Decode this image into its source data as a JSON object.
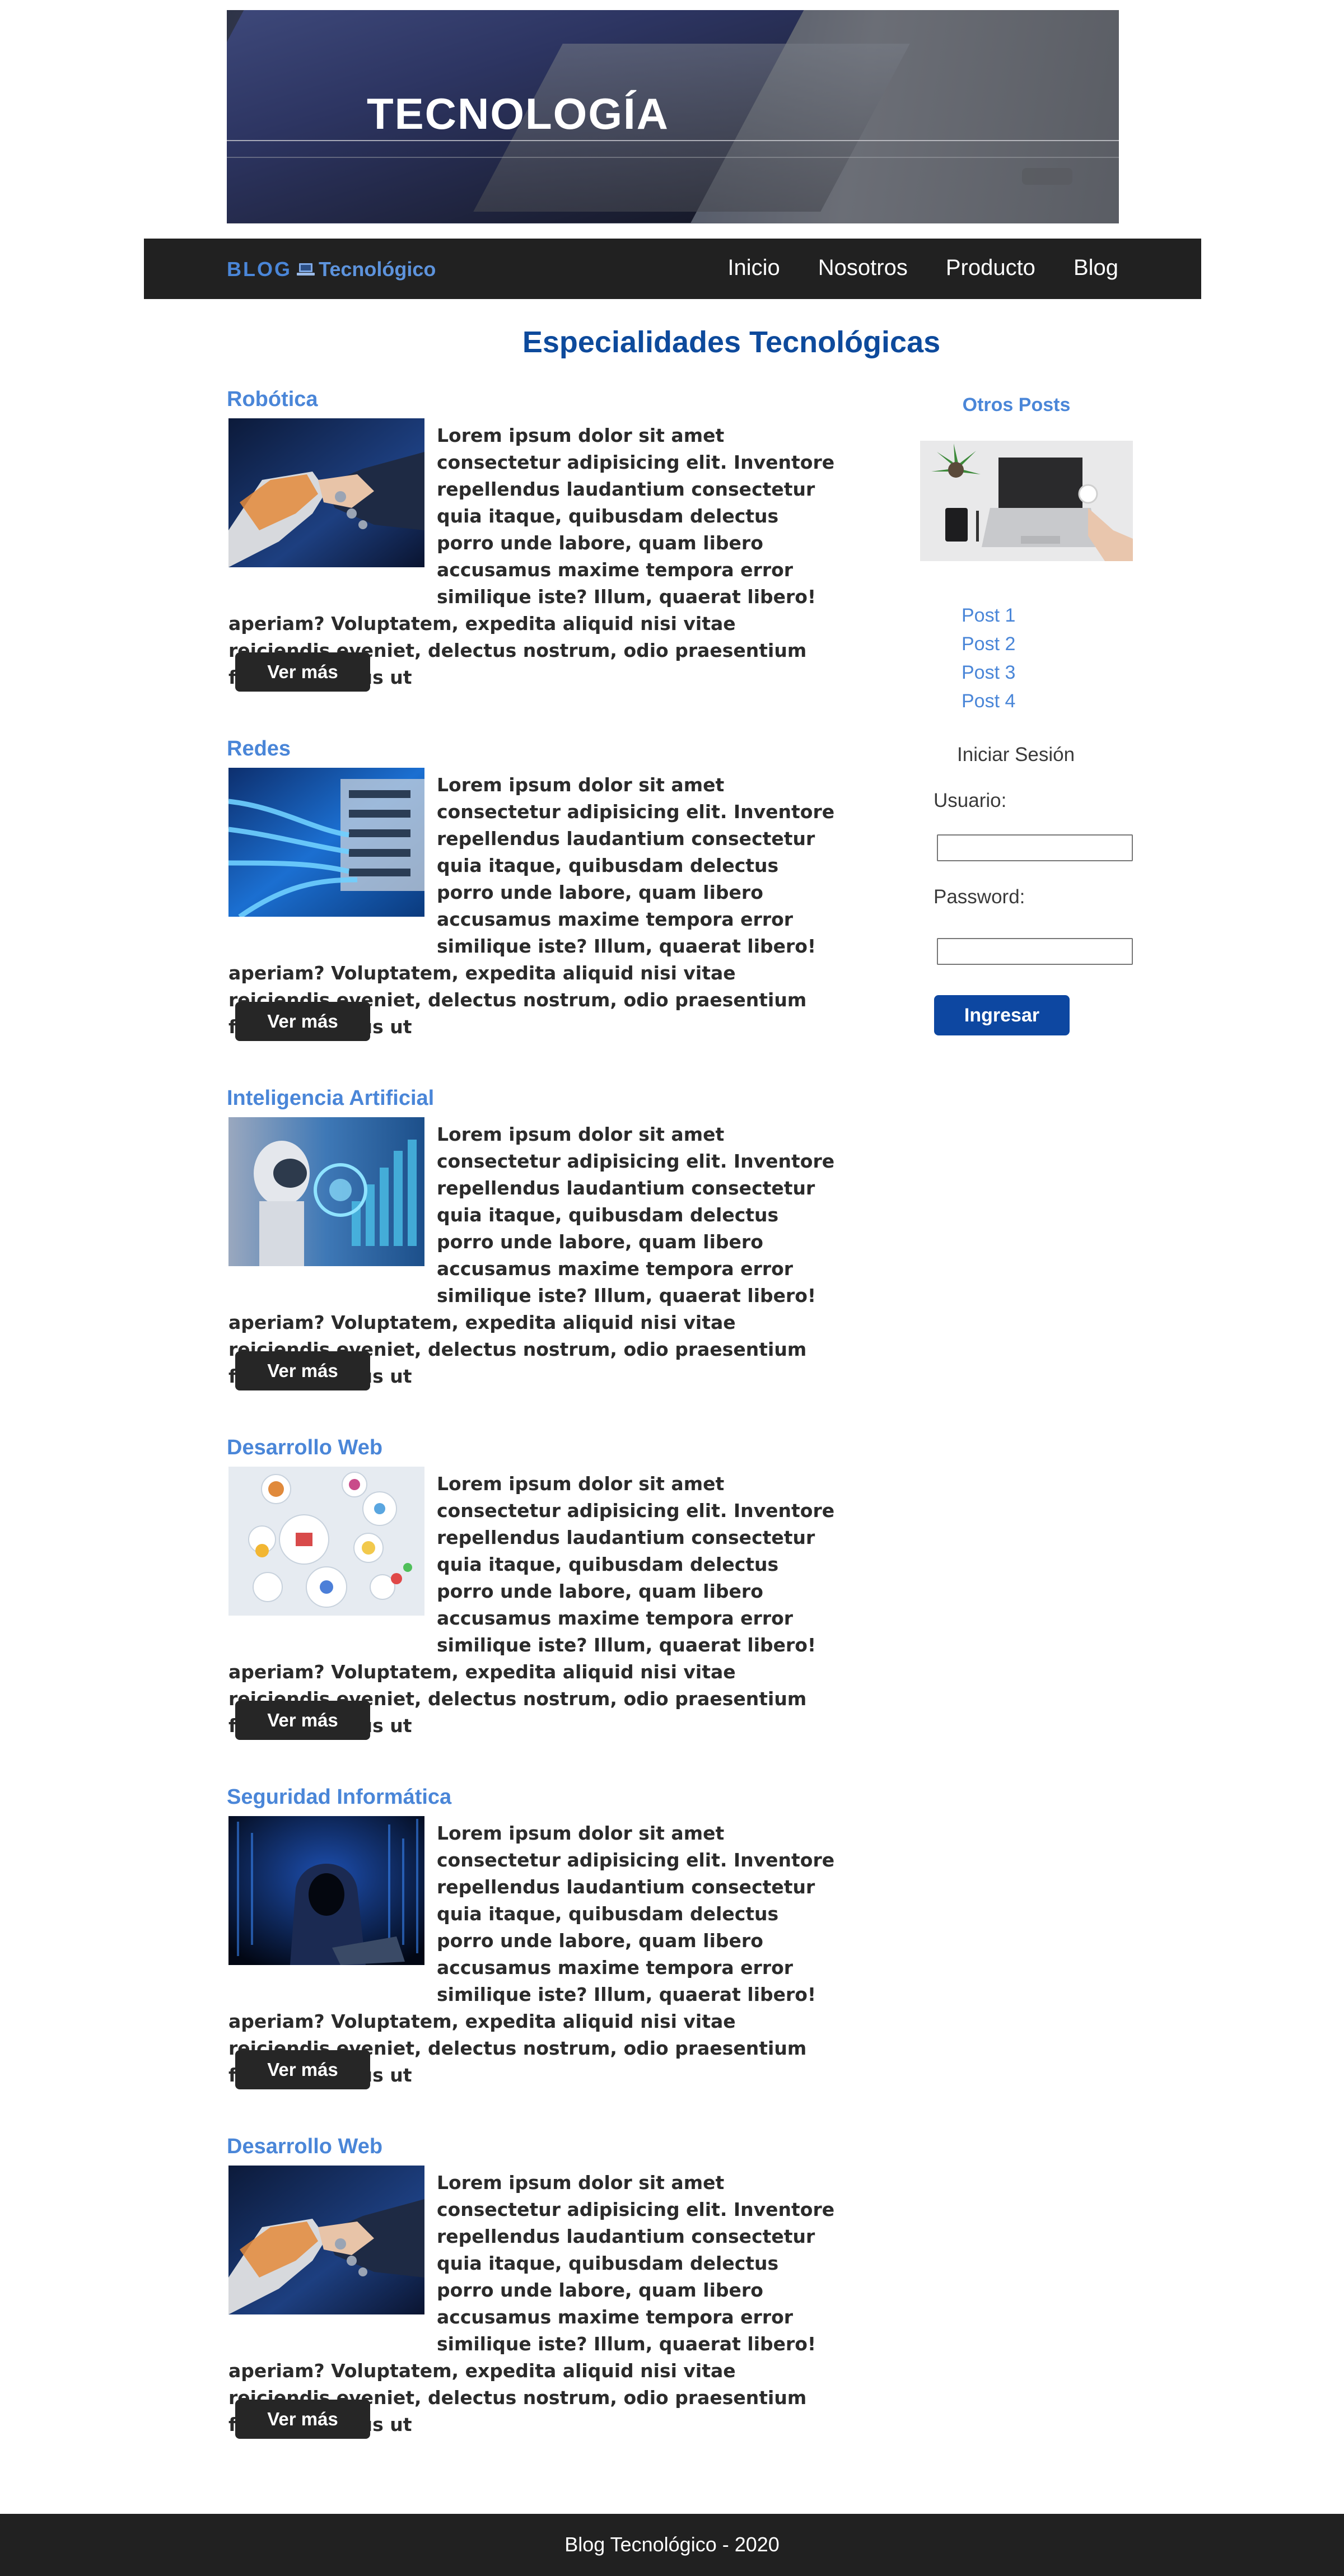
{
  "banner": {
    "title": "TECNOLOGÍA"
  },
  "navbar": {
    "brand_part1": "BLOG",
    "brand_icon": "laptop-icon",
    "brand_part2": "Tecnológico",
    "links": [
      "Inicio",
      "Nosotros",
      "Producto",
      "Blog"
    ]
  },
  "main": {
    "title": "Especialidades Tecnológicas",
    "articles": [
      {
        "title": "Robótica",
        "image": "robot-handshake",
        "text": "Lorem ipsum dolor sit amet consectetur adipisicing elit. Inventore repellendus laudantium consectetur quia itaque, quibusdam delectus porro unde labore, quam libero accusamus maxime tempora error similique iste? Illum, quaerat libero! aperiam? Voluptatem, expedita aliquid nisi vitae reiciendis eveniet, delectus nostrum, odio praesentium facilis ducimus ut",
        "button": "Ver más"
      },
      {
        "title": "Redes",
        "image": "network-cables",
        "text": "Lorem ipsum dolor sit amet consectetur adipisicing elit. Inventore repellendus laudantium consectetur quia itaque, quibusdam delectus porro unde labore, quam libero accusamus maxime tempora error similique iste? Illum, quaerat libero! aperiam? Voluptatem, expedita aliquid nisi vitae reiciendis eveniet, delectus nostrum, odio praesentium facilis ducimus ut",
        "button": "Ver más"
      },
      {
        "title": "Inteligencia Artificial",
        "image": "ai-robot",
        "text": "Lorem ipsum dolor sit amet consectetur adipisicing elit. Inventore repellendus laudantium consectetur quia itaque, quibusdam delectus porro unde labore, quam libero accusamus maxime tempora error similique iste? Illum, quaerat libero! aperiam? Voluptatem, expedita aliquid nisi vitae reiciendis eveniet, delectus nostrum, odio praesentium facilis ducimus ut",
        "button": "Ver más"
      },
      {
        "title": "Desarrollo Web",
        "image": "web-dev-diagram",
        "text": "Lorem ipsum dolor sit amet consectetur adipisicing elit. Inventore repellendus laudantium consectetur quia itaque, quibusdam delectus porro unde labore, quam libero accusamus maxime tempora error similique iste? Illum, quaerat libero! aperiam? Voluptatem, expedita aliquid nisi vitae reiciendis eveniet, delectus nostrum, odio praesentium facilis ducimus ut",
        "button": "Ver más"
      },
      {
        "title": "Seguridad Informática",
        "image": "hacker-hood",
        "text": "Lorem ipsum dolor sit amet consectetur adipisicing elit. Inventore repellendus laudantium consectetur quia itaque, quibusdam delectus porro unde labore, quam libero accusamus maxime tempora error similique iste? Illum, quaerat libero! aperiam? Voluptatem, expedita aliquid nisi vitae reiciendis eveniet, delectus nostrum, odio praesentium facilis ducimus ut",
        "button": "Ver más"
      },
      {
        "title": "Desarrollo Web",
        "image": "robot-handshake",
        "text": "Lorem ipsum dolor sit amet consectetur adipisicing elit. Inventore repellendus laudantium consectetur quia itaque, quibusdam delectus porro unde labore, quam libero accusamus maxime tempora error similique iste? Illum, quaerat libero! aperiam? Voluptatem, expedita aliquid nisi vitae reiciendis eveniet, delectus nostrum, odio praesentium facilis ducimus ut",
        "button": "Ver más"
      }
    ]
  },
  "sidebar": {
    "title": "Otros Posts",
    "image": "laptop-desk",
    "posts": [
      "Post 1",
      "Post 2",
      "Post 3",
      "Post 4"
    ],
    "login": {
      "title": "Iniciar Sesión",
      "user_label": "Usuario:",
      "user_value": "",
      "password_label": "Password:",
      "password_value": "",
      "button": "Ingresar"
    }
  },
  "footer": {
    "text": "Blog Tecnológico - 2020"
  },
  "colors": {
    "accent_blue": "#4a86d8",
    "title_blue": "#0d4a9c",
    "button_blue": "#0d47a1",
    "dark": "#212121"
  }
}
